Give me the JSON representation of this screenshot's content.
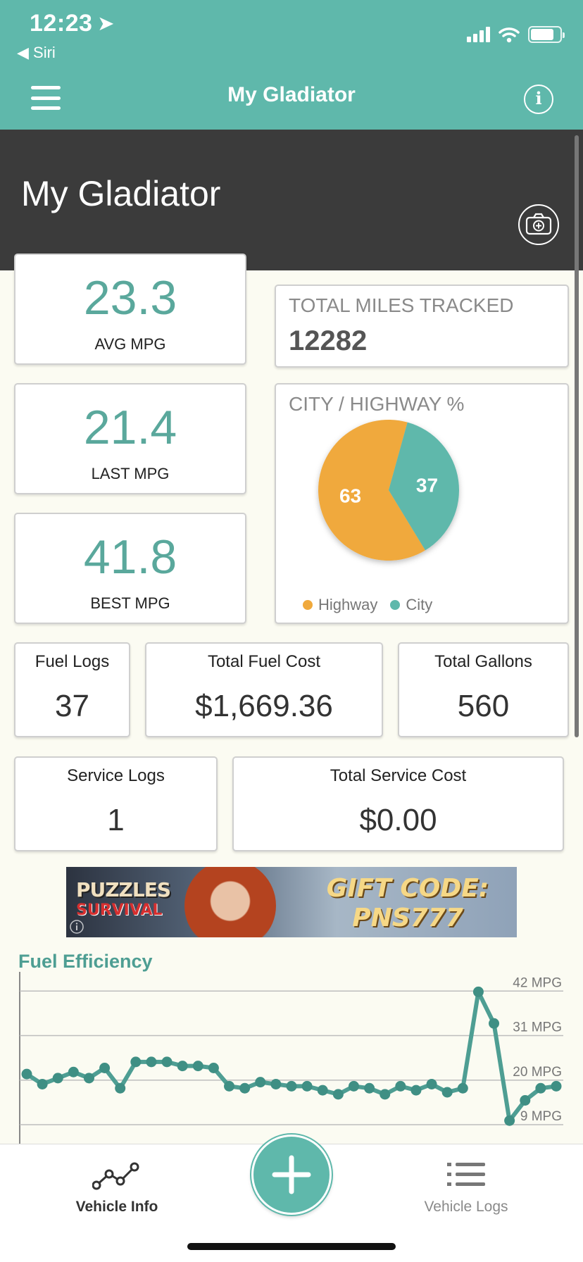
{
  "status": {
    "time": "12:23",
    "back_label": "◀ Siri",
    "battery_level": 0.8
  },
  "navbar": {
    "title": "My Gladiator"
  },
  "header": {
    "vehicle_name": "My Gladiator"
  },
  "mpg": {
    "avg": {
      "value": "23.3",
      "label": "AVG MPG"
    },
    "last": {
      "value": "21.4",
      "label": "LAST MPG"
    },
    "best": {
      "value": "41.8",
      "label": "BEST MPG"
    }
  },
  "miles": {
    "title": "TOTAL MILES TRACKED",
    "value": "12282"
  },
  "city_highway": {
    "title": "CITY / HIGHWAY %",
    "highway_value": "63",
    "city_value": "37",
    "highway_label": "Highway",
    "city_label": "City",
    "highway_color": "#f0a93c",
    "city_color": "#5fb8ab"
  },
  "fuel_stats": {
    "logs_label": "Fuel Logs",
    "logs_value": "37",
    "cost_label": "Total Fuel Cost",
    "cost_value": "$1,669.36",
    "gallons_label": "Total Gallons",
    "gallons_value": "560"
  },
  "service_stats": {
    "logs_label": "Service Logs",
    "logs_value": "1",
    "cost_label": "Total Service Cost",
    "cost_value": "$0.00"
  },
  "ad": {
    "brand_line1": "PUZZLES",
    "brand_line2": "SURVIVAL",
    "code_line1": "GIFT CODE:",
    "code_line2": "PNS777"
  },
  "chart_data": {
    "type": "line",
    "title": "Fuel Efficiency",
    "y_ticks": [
      "42 MPG",
      "31 MPG",
      "20 MPG",
      "9 MPG"
    ],
    "y_tick_values": [
      42,
      31,
      20,
      9
    ],
    "ylim": [
      5,
      45
    ],
    "series": [
      {
        "values": [
          21.5,
          19,
          20.5,
          22,
          20.5,
          23,
          18,
          24.5,
          24.5,
          24.5,
          23.5,
          23.5,
          23,
          18.5,
          18,
          19.5,
          19,
          18.5,
          18.5,
          17.5,
          16.5,
          18.5,
          18,
          16.5,
          18.5,
          17.5,
          19,
          17,
          18,
          41.8,
          34,
          10,
          15,
          18,
          18.5
        ]
      }
    ]
  },
  "tabs": {
    "vehicle_info": "Vehicle Info",
    "vehicle_logs": "Vehicle Logs"
  }
}
